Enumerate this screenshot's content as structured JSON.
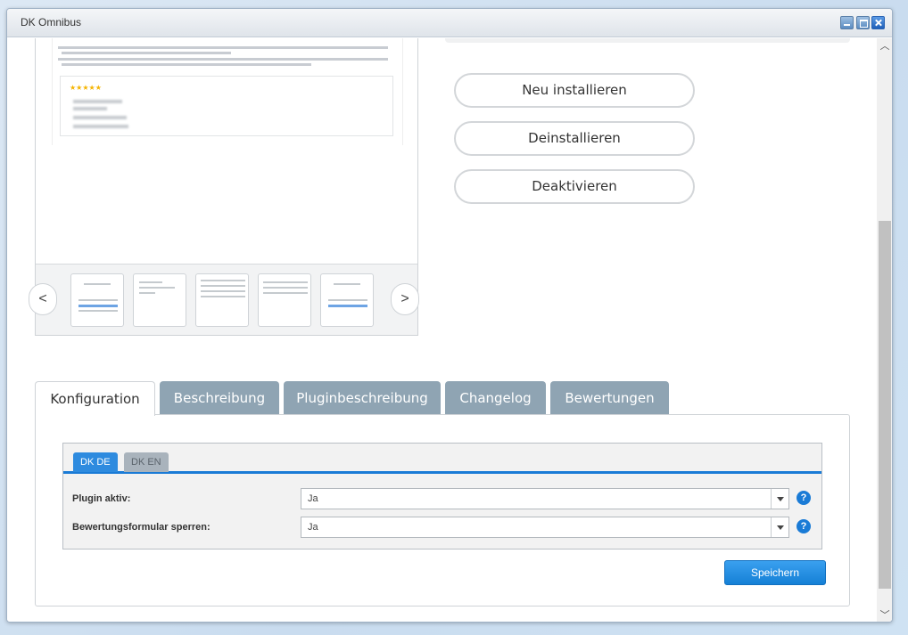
{
  "window": {
    "title": "DK Omnibus"
  },
  "actions": {
    "reinstall": "Neu installieren",
    "uninstall": "Deinstallieren",
    "deactivate": "Deaktivieren"
  },
  "gallery": {
    "prev": "<",
    "next": ">",
    "thumbnail_count": 5
  },
  "tabs": [
    {
      "label": "Konfiguration",
      "active": true
    },
    {
      "label": "Beschreibung",
      "active": false
    },
    {
      "label": "Pluginbeschreibung",
      "active": false
    },
    {
      "label": "Changelog",
      "active": false
    },
    {
      "label": "Bewertungen",
      "active": false
    }
  ],
  "config": {
    "subtabs": [
      {
        "label": "DK DE",
        "active": true
      },
      {
        "label": "DK EN",
        "active": false
      }
    ],
    "fields": [
      {
        "label": "Plugin aktiv:",
        "value": "Ja",
        "help": "?"
      },
      {
        "label": "Bewertungsformular sperren:",
        "value": "Ja",
        "help": "?"
      }
    ],
    "save_label": "Speichern"
  },
  "colors": {
    "accent": "#1a7bd6",
    "tab_inactive": "#8fa4b3",
    "save_button": "#1580d6"
  }
}
